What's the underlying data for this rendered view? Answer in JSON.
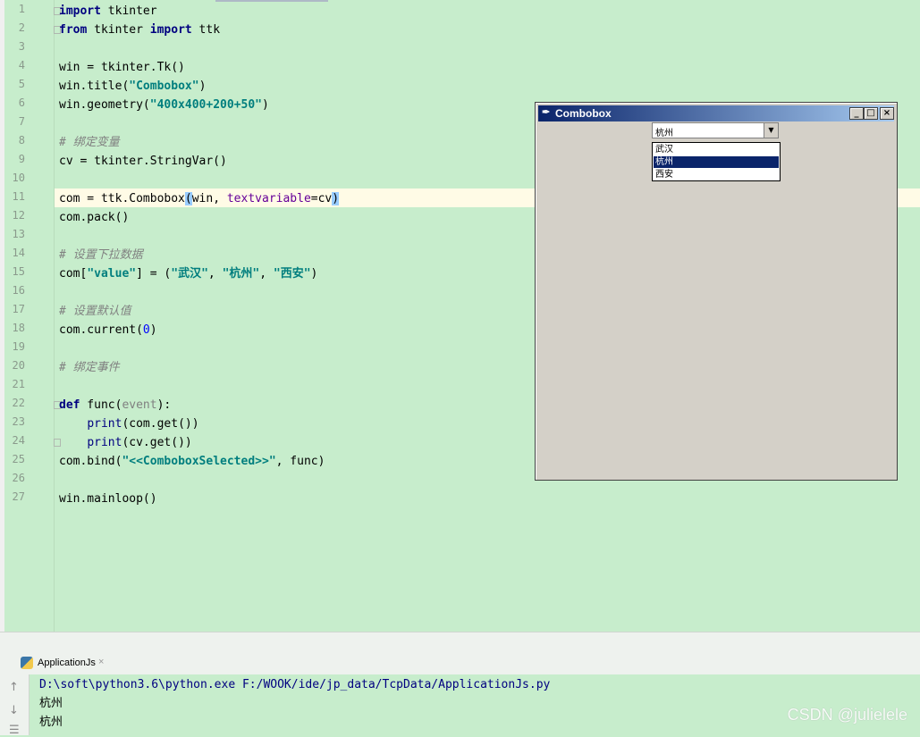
{
  "editor": {
    "line_numbers": [
      "1",
      "2",
      "3",
      "4",
      "5",
      "6",
      "7",
      "8",
      "9",
      "10",
      "11",
      "12",
      "13",
      "14",
      "15",
      "16",
      "17",
      "18",
      "19",
      "20",
      "21",
      "22",
      "23",
      "24",
      "25",
      "26",
      "27"
    ],
    "code": {
      "l1_kw": "import",
      "l1_rest": " tkinter",
      "l2_kw1": "from",
      "l2_mid": " tkinter ",
      "l2_kw2": "import",
      "l2_rest": " ttk",
      "l4": "win = tkinter.Tk()",
      "l5_a": "win.title(",
      "l5_s": "\"Combobox\"",
      "l5_b": ")",
      "l6_a": "win.geometry(",
      "l6_s": "\"400x400+200+50\"",
      "l6_b": ")",
      "l8": "# 绑定变量",
      "l9": "cv = tkinter.StringVar()",
      "l11_a": "com = ttk.Combobox",
      "l11_p1": "(",
      "l11_b": "win, ",
      "l11_param": "textvariable",
      "l11_c": "=cv",
      "l11_p2": ")",
      "l12": "com.pack()",
      "l14": "# 设置下拉数据",
      "l15_a": "com[",
      "l15_s1": "\"value\"",
      "l15_b": "] = (",
      "l15_s2": "\"武汉\"",
      "l15_c": ", ",
      "l15_s3": "\"杭州\"",
      "l15_d": ", ",
      "l15_s4": "\"西安\"",
      "l15_e": ")",
      "l17": "# 设置默认值",
      "l18_a": "com.current(",
      "l18_n": "0",
      "l18_b": ")",
      "l20": "# 绑定事件",
      "l22_kw": "def",
      "l22_a": " func(",
      "l22_p": "event",
      "l22_b": "):",
      "l23_i": "    ",
      "l23_bi": "print",
      "l23_a": "(com.get())",
      "l24_i": "    ",
      "l24_bi": "print",
      "l24_a": "(cv.get())",
      "l25_a": "com.bind(",
      "l25_s": "\"<<ComboboxSelected>>\"",
      "l25_b": ", func)",
      "l27": "win.mainloop()"
    }
  },
  "tk_window": {
    "title": "Combobox",
    "combobox_value": "杭州",
    "options": [
      "武汉",
      "杭州",
      "西安"
    ],
    "selected_index": 1,
    "buttons": {
      "minimize": "_",
      "maximize": "□",
      "close": "×"
    }
  },
  "run_panel": {
    "tab_label": "ApplicationJs",
    "tab_close": "×",
    "output": [
      "D:\\soft\\python3.6\\python.exe F:/WOOK/ide/jp_data/TcpData/ApplicationJs.py",
      "杭州",
      "杭州"
    ],
    "side_icons": [
      "arrow-up-icon",
      "arrow-down-icon",
      "menu-icon"
    ]
  },
  "watermark": "CSDN @julielele",
  "colors": {
    "editor_bg": "#c7edcc",
    "keyword": "#000080",
    "string": "#007e7e",
    "comment": "#808080",
    "title_bar": "#0a246a"
  }
}
